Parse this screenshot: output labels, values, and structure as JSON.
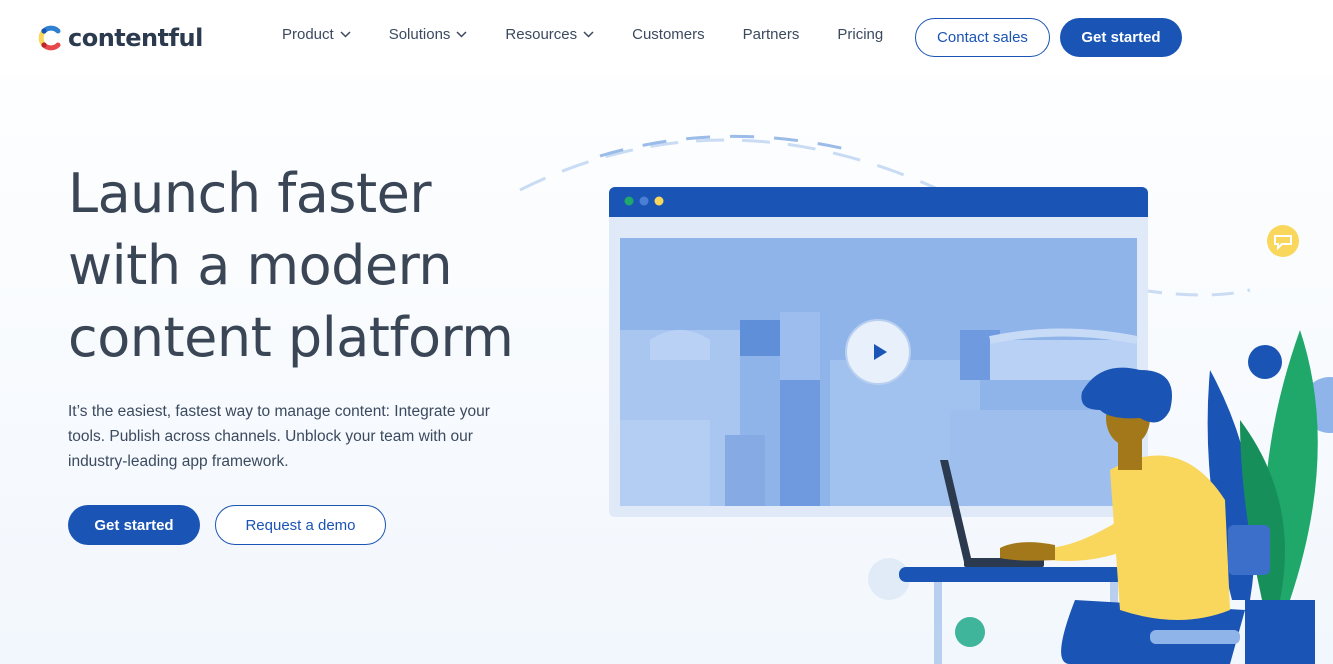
{
  "brand": {
    "name": "contentful",
    "primary_color": "#1a54b5",
    "text_color": "#3a4555"
  },
  "nav": {
    "items": [
      {
        "label": "Product",
        "has_dropdown": true
      },
      {
        "label": "Solutions",
        "has_dropdown": true
      },
      {
        "label": "Resources",
        "has_dropdown": true
      },
      {
        "label": "Customers",
        "has_dropdown": false
      },
      {
        "label": "Partners",
        "has_dropdown": false
      },
      {
        "label": "Pricing",
        "has_dropdown": false
      }
    ],
    "contact_label": "Contact sales",
    "get_started_label": "Get started"
  },
  "hero": {
    "headline_line1": "Launch faster",
    "headline_line2": "with a modern",
    "headline_line3": "content platform",
    "subtext": "It’s the easiest, fastest way to manage content: Integrate your tools. Publish across channels. Unblock your team with our industry-leading app framework.",
    "primary_cta": "Get started",
    "secondary_cta": "Request a demo"
  },
  "illustration": {
    "icons": [
      "play-icon",
      "chat-icon"
    ],
    "colors": {
      "window_bar": "#1a54b5",
      "screen": "#8fb4ea",
      "person_shirt": "#f9d65c",
      "person_hair": "#1a54b5",
      "plant": "#1fa86a"
    }
  }
}
